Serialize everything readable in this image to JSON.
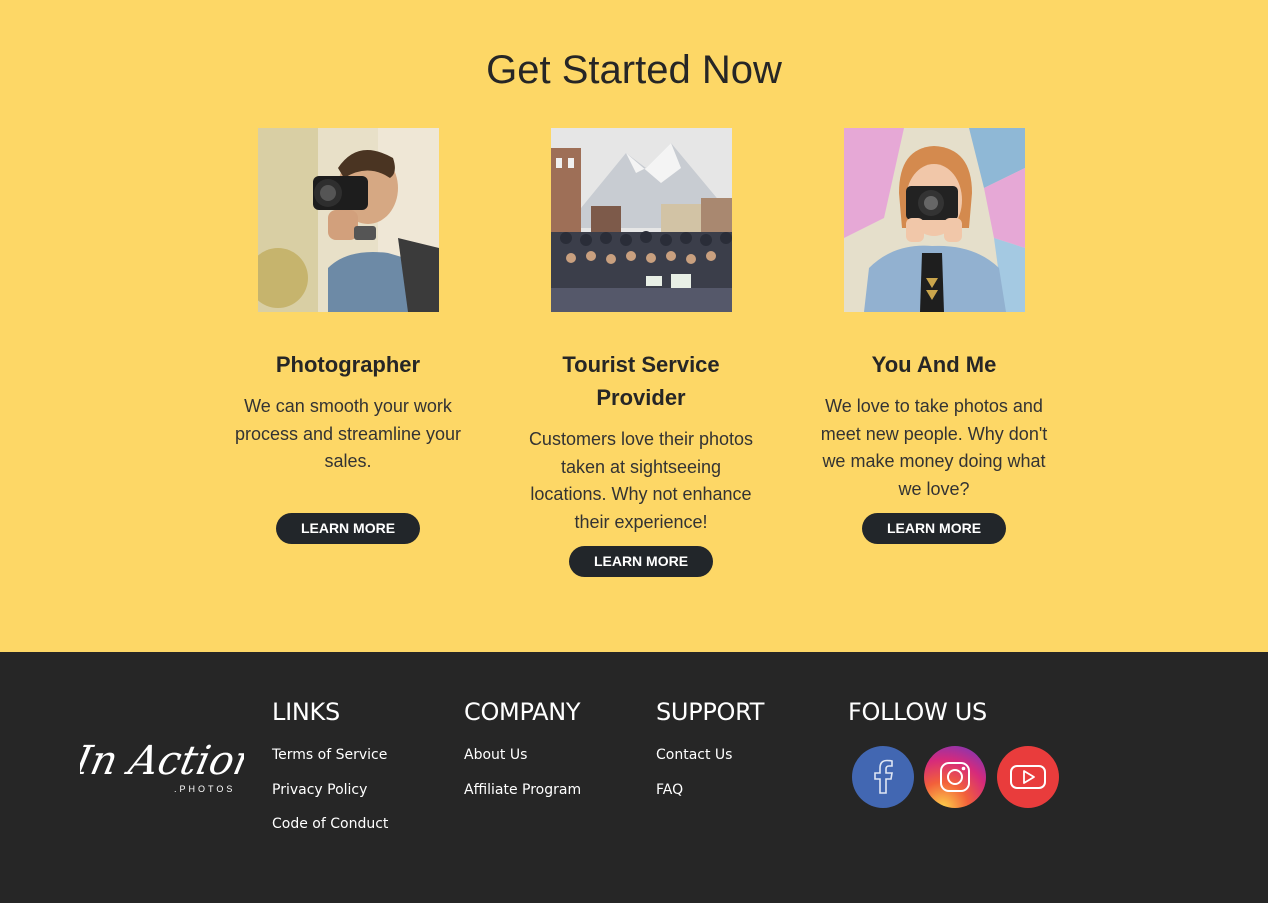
{
  "hero": {
    "title": "Get Started Now"
  },
  "cards": [
    {
      "title": "Photographer",
      "text": "We can smooth your work process and streamline your sales.",
      "button": "LEARN MORE",
      "photo": "man-with-camera-photo"
    },
    {
      "title": "Tourist Service Provider",
      "text": "Customers love their photos taken at sightseeing locations. Why not enhance their experience!",
      "button": "LEARN MORE",
      "photo": "tour-group-photo"
    },
    {
      "title": "You And Me",
      "text": "We love to take photos and meet new people. Why don't we make money doing what we love?",
      "button": "LEARN MORE",
      "photo": "woman-with-camera-photo"
    }
  ],
  "footer": {
    "logo": {
      "main": "In Action",
      "sub": ".PHOTOS"
    },
    "links": {
      "heading": "LINKS",
      "items": [
        "Terms of Service",
        "Privacy Policy",
        "Code of Conduct"
      ]
    },
    "company": {
      "heading": "COMPANY",
      "items": [
        "About Us",
        "Affiliate Program"
      ]
    },
    "support": {
      "heading": "SUPPORT",
      "items": [
        "Contact Us",
        "FAQ"
      ]
    },
    "follow": {
      "heading": "FOLLOW US",
      "icons": [
        "facebook-icon",
        "instagram-icon",
        "youtube-icon"
      ]
    }
  },
  "colors": {
    "background": "#fdd766",
    "footer": "#262626",
    "button": "#22262a"
  }
}
